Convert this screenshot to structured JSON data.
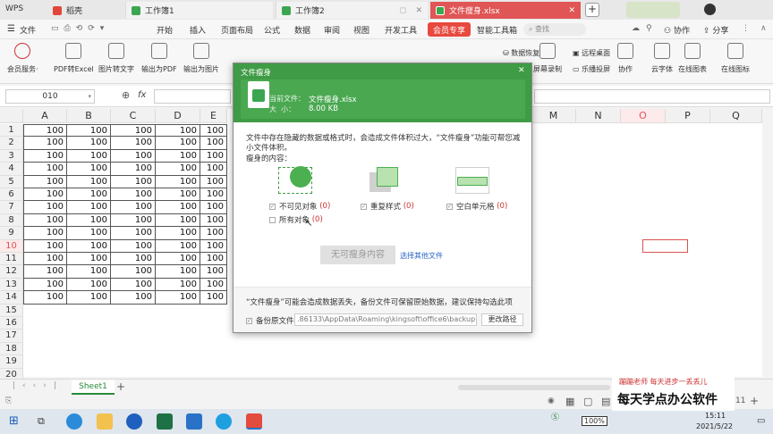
{
  "titlebar": {
    "app": "WPS",
    "tabs": [
      {
        "label": "稻壳",
        "color": "#e0463a"
      },
      {
        "label": "工作簿1",
        "color": "#3aa650"
      },
      {
        "label": "工作簿2",
        "color": "#3aa650"
      },
      {
        "label": "文件瘦身.xlsx",
        "color": "#3aa650"
      }
    ],
    "new_tab": "+"
  },
  "menubar": {
    "file": "文件",
    "items": [
      "开始",
      "插入",
      "页面布局",
      "公式",
      "数据",
      "审阅",
      "视图",
      "开发工具"
    ],
    "member": "会员专享",
    "smart": "智能工具箱",
    "search": "查找",
    "right": [
      "协作",
      "分享"
    ]
  },
  "ribbon": {
    "items": [
      "会员服务·",
      "PDF转Excel",
      "图片转文字",
      "输出为PDF",
      "输出为图片"
    ],
    "right": [
      {
        "label": "数据恢复",
        "top": true
      },
      {
        "label": "屏幕录制"
      },
      {
        "label": "远程桌面",
        "top": true
      },
      {
        "label": "乐播投屏"
      },
      {
        "label": "协作"
      },
      {
        "label": "云字体"
      },
      {
        "label": "在线图表"
      },
      {
        "label": "在线图标"
      }
    ]
  },
  "formulabar": {
    "name_box": "010",
    "fx": "fx"
  },
  "grid": {
    "columns": [
      "A",
      "B",
      "C",
      "D",
      "E",
      "M",
      "N",
      "O",
      "P",
      "Q"
    ],
    "rows": [
      "1",
      "2",
      "3",
      "4",
      "5",
      "6",
      "7",
      "8",
      "9",
      "10",
      "11",
      "12",
      "13",
      "14",
      "15",
      "16",
      "17",
      "18",
      "19",
      "20"
    ],
    "cell_value": "100"
  },
  "sheetbar": {
    "sheet": "Sheet1",
    "add": "+"
  },
  "statusbar": {
    "zoom": "11"
  },
  "taskbar": {
    "time": "15:11",
    "date": "2021/5/22",
    "battery": "100%"
  },
  "dialog": {
    "title": "文件瘦身",
    "current_file_label": "当前文件：",
    "current_file": "文件瘦身.xlsx",
    "size_label": "大  小：",
    "size": "8.00 KB",
    "description": "文件中存在隐藏的数据或格式时，会造成文件体积过大，“文件瘦身”功能可帮您减小文件体积。",
    "content_label": "瘦身的内容：",
    "options": [
      {
        "label": "不可见对象",
        "count": "(0)"
      },
      {
        "label": "重复样式",
        "count": "(0)"
      },
      {
        "label": "空白单元格",
        "count": "(0)"
      },
      {
        "label": "所有对象",
        "count": "(0)"
      }
    ],
    "slim_button": "无可瘦身内容",
    "other_file_link": "选择其他文件",
    "warning": "“文件瘦身”可能会造成数据丢失，备份文件可保留原始数据，建议保持勾选此项",
    "backup_label": "备份原文件",
    "backup_path": ".86133\\AppData\\Roaming\\kingsoft\\office6\\backup",
    "change_path": "更改路径"
  },
  "watermark": {
    "line1": "蹦蹦老师  每天进步一丢丢儿",
    "line2": "每天学点办公软件"
  }
}
